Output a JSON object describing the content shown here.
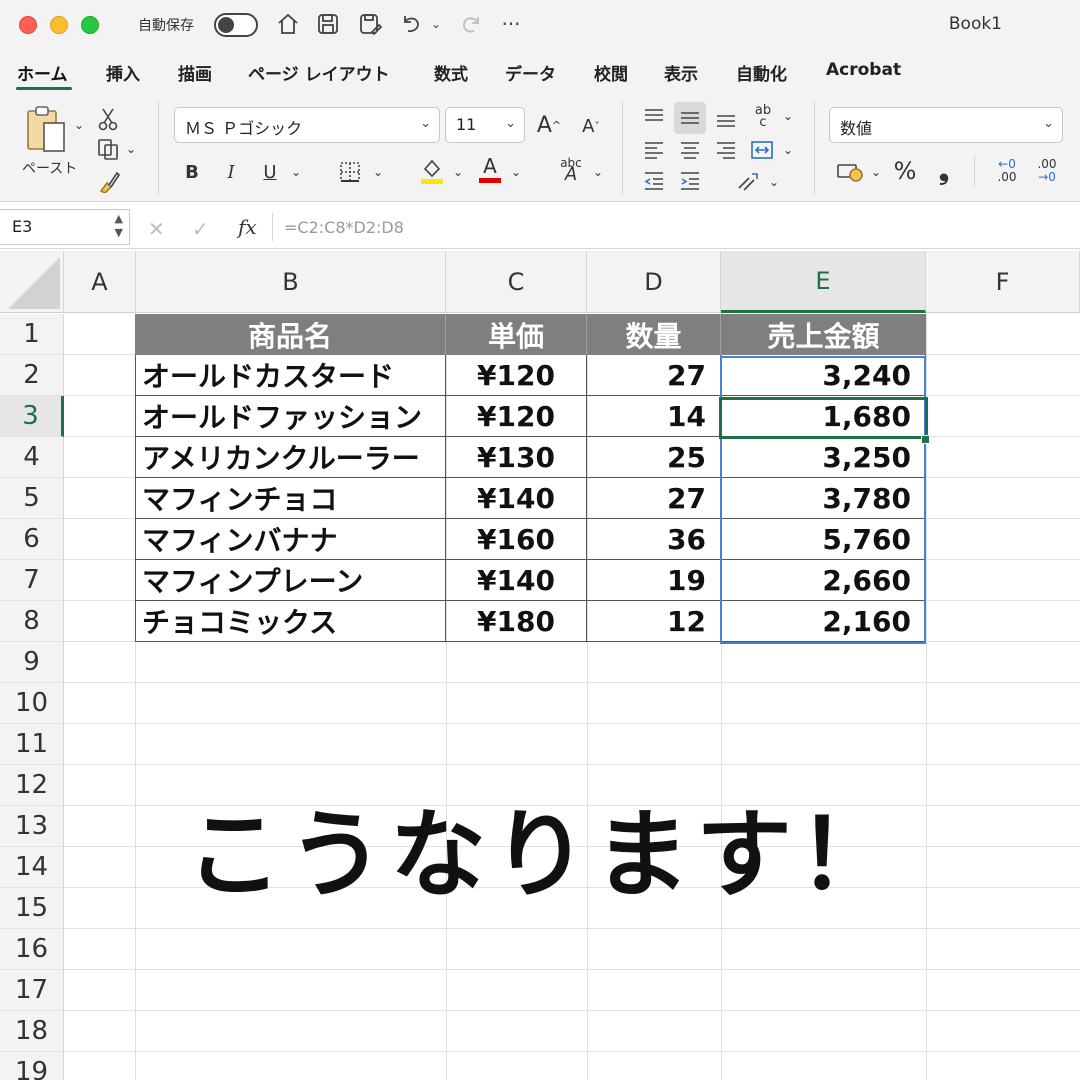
{
  "titlebar": {
    "autosave_label": "自動保存",
    "window_title": "Book1",
    "icons": [
      "home-icon",
      "save-icon",
      "save-as-icon",
      "undo-icon",
      "redo-icon",
      "more-icon"
    ]
  },
  "tabs": [
    "ホーム",
    "挿入",
    "描画",
    "ページ レイアウト",
    "数式",
    "データ",
    "校閲",
    "表示",
    "自動化",
    "Acrobat"
  ],
  "ribbon": {
    "paste_label": "ペースト",
    "font_name": "ＭＳ Ｐゴシック",
    "font_size": "11",
    "bold": "B",
    "italic": "I",
    "underline": "U",
    "number_format": "数値",
    "percent": "%",
    "comma": "❟",
    "dec_inc_top": "←0",
    "dec_inc_bottom": ".00",
    "dec_dec_top": ".00",
    "dec_dec_bottom": "→0",
    "font_grow": "A",
    "font_shrink": "A",
    "font_color_letter": "A",
    "abc_label": "abc",
    "ab_label": "ab",
    "accent_color": "#1e7145"
  },
  "formula_bar": {
    "name_box": "E3",
    "fx": "fx",
    "formula": "=C2:C8*D2:D8"
  },
  "sheet": {
    "columns": [
      "A",
      "B",
      "C",
      "D",
      "E",
      "F"
    ],
    "selected_column": "E",
    "rows": [
      "1",
      "2",
      "3",
      "4",
      "5",
      "6",
      "7",
      "8",
      "9",
      "10",
      "11",
      "12",
      "13",
      "14",
      "15",
      "16",
      "17",
      "18",
      "19"
    ],
    "selected_row": "3",
    "table": {
      "headers": [
        "商品名",
        "単価",
        "数量",
        "売上金額"
      ],
      "rows": [
        [
          "オールドカスタード",
          "¥120",
          "27",
          "3,240"
        ],
        [
          "オールドファッション",
          "¥120",
          "14",
          "1,680"
        ],
        [
          "アメリカンクルーラー",
          "¥130",
          "25",
          "3,250"
        ],
        [
          "マフィンチョコ",
          "¥140",
          "27",
          "3,780"
        ],
        [
          "マフィンバナナ",
          "¥160",
          "36",
          "5,760"
        ],
        [
          "マフィンプレーン",
          "¥140",
          "19",
          "2,660"
        ],
        [
          "チョコミックス",
          "¥180",
          "12",
          "2,160"
        ]
      ]
    },
    "overlay_text": "こうなります！"
  }
}
